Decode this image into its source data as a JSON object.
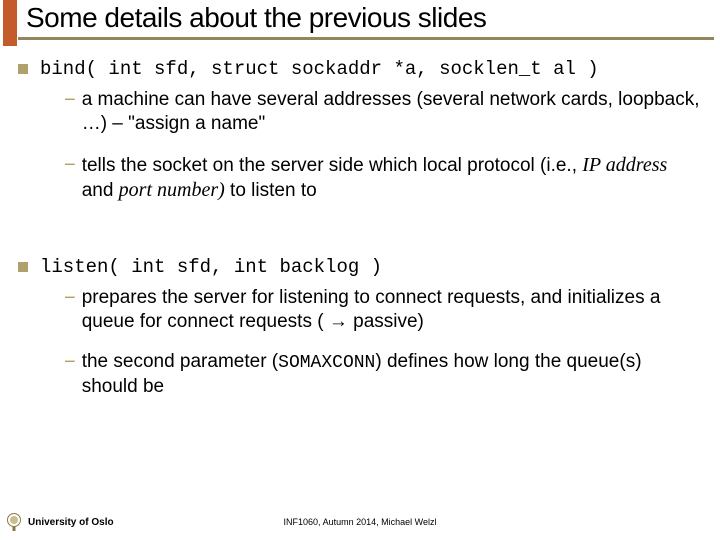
{
  "title": "Some details about the previous slides",
  "bullets": [
    {
      "code": "bind( int sfd, struct sockaddr *a, socklen_t al )",
      "subs": [
        {
          "pre": "a machine can have several addresses (several network cards, loopback, …) – \"assign a name\""
        },
        {
          "pre": "tells the socket on the server side which local protocol (i.e., ",
          "italic": "IP address",
          "mid": " and ",
          "italic2": "port number)",
          "post": "  to listen to"
        }
      ]
    },
    {
      "code": "listen( int sfd, int backlog )",
      "subs": [
        {
          "pre": "prepares the server for listening to connect requests, and initializes a queue for connect requests ( ",
          "arrow": "→",
          "post": "  passive)"
        },
        {
          "pre": "the second parameter (",
          "mono": "SOMAXCONN",
          "post": ") defines how long the queue(s) should be"
        }
      ]
    }
  ],
  "footer": {
    "university": "University of Oslo",
    "center": "INF1060, Autumn 2014, Michael Welzl"
  }
}
